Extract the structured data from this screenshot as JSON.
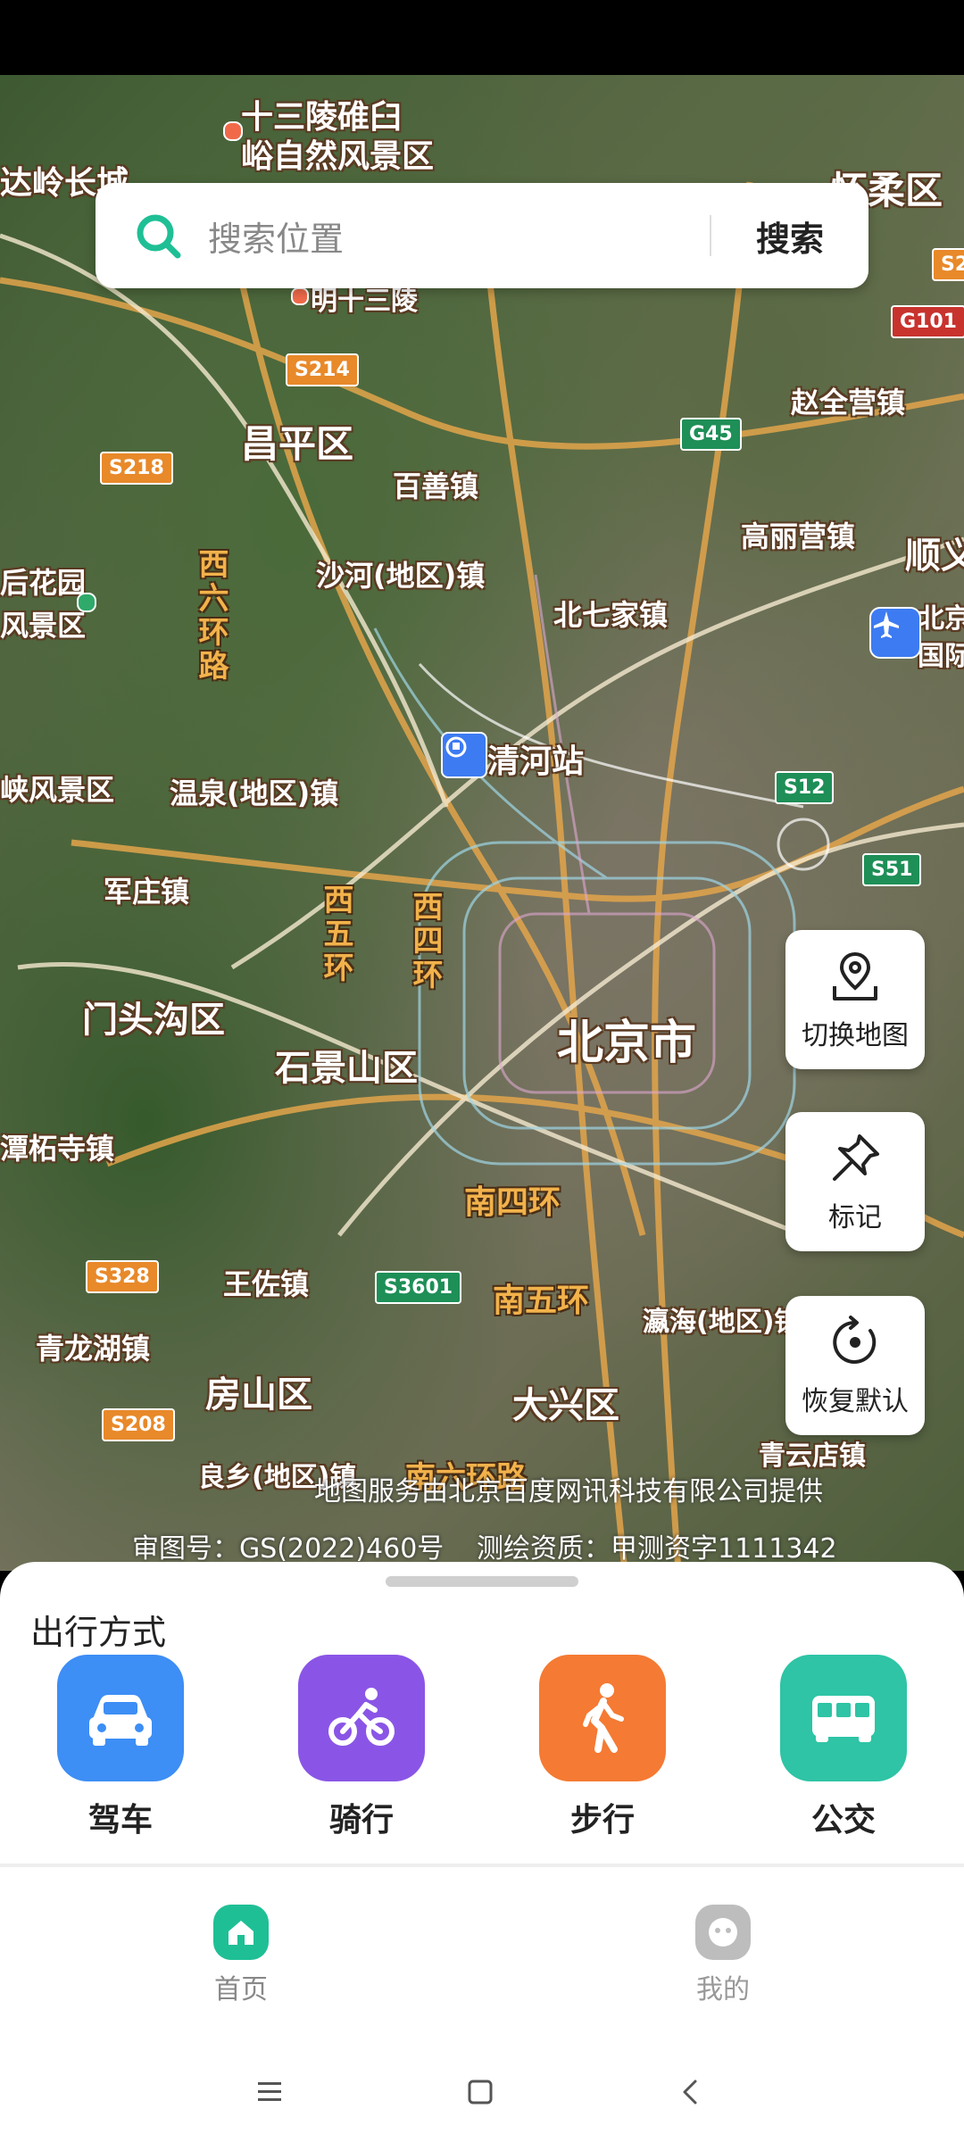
{
  "search": {
    "placeholder": "搜索位置",
    "button_label": "搜索"
  },
  "map": {
    "places": [
      {
        "text": "十三陵碓臼",
        "size": "med"
      },
      {
        "text": "峪自然风景区",
        "size": "med"
      },
      {
        "text": "达岭长城",
        "size": "med"
      },
      {
        "text": "怀柔区",
        "size": "big"
      },
      {
        "text": "明十三陵",
        "size": "sm"
      },
      {
        "text": "昌平区",
        "size": "big"
      },
      {
        "text": "百善镇",
        "size": "med"
      },
      {
        "text": "赵全营镇",
        "size": "med"
      },
      {
        "text": "沙河(地区)镇",
        "size": "med"
      },
      {
        "text": "高丽营镇",
        "size": "med"
      },
      {
        "text": "顺义",
        "size": "big"
      },
      {
        "text": "北七家镇",
        "size": "med"
      },
      {
        "text": "后花园",
        "size": "med"
      },
      {
        "text": "风景区",
        "size": "med"
      },
      {
        "text": "北京",
        "size": "med"
      },
      {
        "text": "国际",
        "size": "med"
      },
      {
        "text": "清河站",
        "size": "big"
      },
      {
        "text": "峡风景区",
        "size": "med"
      },
      {
        "text": "温泉(地区)镇",
        "size": "med"
      },
      {
        "text": "军庄镇",
        "size": "med"
      },
      {
        "text": "门头沟区",
        "size": "big"
      },
      {
        "text": "石景山区",
        "size": "big"
      },
      {
        "text": "北京市",
        "size": "big"
      },
      {
        "text": "潭柘寺镇",
        "size": "med"
      },
      {
        "text": "王佐镇",
        "size": "med"
      },
      {
        "text": "青龙湖镇",
        "size": "med"
      },
      {
        "text": "房山区",
        "size": "big"
      },
      {
        "text": "大兴区",
        "size": "big"
      },
      {
        "text": "瀛海(地区)镇",
        "size": "med"
      },
      {
        "text": "青云店镇",
        "size": "med"
      },
      {
        "text": "良乡(地区)镇",
        "size": "med"
      }
    ],
    "rings": [
      {
        "text": "西六环路"
      },
      {
        "text": "西五环"
      },
      {
        "text": "西四环"
      },
      {
        "text": "南四环"
      },
      {
        "text": "南五环"
      },
      {
        "text": "南六环路"
      }
    ],
    "shields": [
      {
        "text": "S214",
        "color": "#e8892a"
      },
      {
        "text": "S218",
        "color": "#e8892a"
      },
      {
        "text": "G45",
        "color": "#1e8f57"
      },
      {
        "text": "G101",
        "color": "#c8332e"
      },
      {
        "text": "S2",
        "color": "#e8892a"
      },
      {
        "text": "S12",
        "color": "#1e8f57"
      },
      {
        "text": "S51",
        "color": "#1e8f57"
      },
      {
        "text": "S328",
        "color": "#e8892a"
      },
      {
        "text": "S3601",
        "color": "#1e8f57"
      },
      {
        "text": "S208",
        "color": "#e8892a"
      }
    ],
    "credit_line1": "地图服务由北京百度网讯科技有限公司提供",
    "credit_line2": "审图号：GS(2022)460号",
    "credit_line3": "测绘资质：甲测资字1111342"
  },
  "fabs": {
    "switch_map": "切换地图",
    "mark": "标记",
    "reset": "恢复默认"
  },
  "sheet": {
    "title": "出行方式",
    "modes": [
      {
        "label": "驾车",
        "color": "#3d8ef5",
        "icon": "car-icon"
      },
      {
        "label": "骑行",
        "color": "#8a55e6",
        "icon": "bike-icon"
      },
      {
        "label": "步行",
        "color": "#f57a33",
        "icon": "walk-icon"
      },
      {
        "label": "公交",
        "color": "#2ec4a5",
        "icon": "bus-icon"
      }
    ]
  },
  "tabs": [
    {
      "label": "首页",
      "active": true,
      "color": "#1fbf95"
    },
    {
      "label": "我的",
      "active": false,
      "color": "#bdbdbd"
    }
  ],
  "colors": {
    "accent": "#1fbf95"
  }
}
